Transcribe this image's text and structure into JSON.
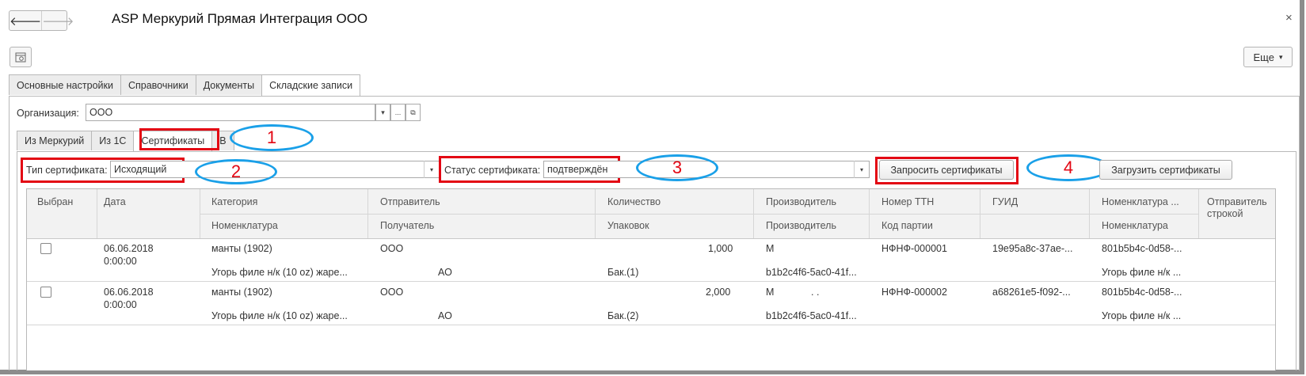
{
  "window": {
    "title": "ASP Меркурий Прямая Интеграция ООО",
    "close_glyph": "×",
    "back_glyph": "🡐",
    "forward_glyph": "🡒"
  },
  "toolbar": {
    "more_label": "Еще",
    "more_arrow": "▾"
  },
  "tabs": [
    {
      "label": "Основные настройки"
    },
    {
      "label": "Справочники"
    },
    {
      "label": "Документы"
    },
    {
      "label": "Складские записи",
      "active": true
    }
  ],
  "organization": {
    "label": "Организация:",
    "value": "ООО",
    "dots": "...",
    "open_glyph": "⧉",
    "arrow": "▾"
  },
  "subtabs": [
    {
      "label": "Из Меркурий"
    },
    {
      "label": "Из 1С"
    },
    {
      "label": "Сертификаты",
      "active": true
    },
    {
      "label": "В"
    }
  ],
  "filters": {
    "type_label": "Тип сертификата:",
    "type_value": "Исходящий",
    "status_label": "Статус сертификата:",
    "status_value": "подтверждён",
    "arrow": "▾",
    "request_button": "Запросить сертификаты",
    "load_button": "Загрузить сертификаты"
  },
  "callouts": [
    "1",
    "2",
    "3",
    "4"
  ],
  "table": {
    "headers_top": [
      "Выбран",
      "Дата",
      "Категория",
      "Отправитель",
      "Количество",
      "Производитель",
      "Номер ТТН",
      "ГУИД",
      "Номенклатура ...",
      "Отправитель строкой"
    ],
    "headers_bottom": [
      "Номенклатура",
      "Получатель",
      "Упаковок",
      "Производитель",
      "Код партии",
      "Номенклатура"
    ],
    "rows": [
      {
        "date": "06.06.2018",
        "time": "0:00:00",
        "category": "манты (1902)",
        "nomenclature": "Угорь филе н/к (10 oz) жаре...",
        "sender": "ООО",
        "receiver": "АО",
        "quantity": "1,000",
        "packages": "Бак.(1)",
        "producer": "М",
        "producer2": "b1b2c4f6-5ac0-41f...",
        "ttn": "НФНФ-000001",
        "guid": "19e95a8c-37ae-...",
        "nom_guid": "801b5b4c-0d58-...",
        "nom2": "Угорь филе н/к ..."
      },
      {
        "date": "06.06.2018",
        "time": "0:00:00",
        "category": "манты (1902)",
        "nomenclature": "Угорь филе н/к (10 oz) жаре...",
        "sender": "ООО",
        "receiver": "АО",
        "quantity": "2,000",
        "packages": "Бак.(2)",
        "producer": "М",
        "producer_dots": ". .",
        "producer2": "b1b2c4f6-5ac0-41f...",
        "ttn": "НФНФ-000002",
        "guid": "a68261e5-f092-...",
        "nom_guid": "801b5b4c-0d58-...",
        "nom2": "Угорь филе н/к ..."
      }
    ]
  },
  "colors": {
    "highlight_red": "#e30613",
    "ellipse_blue": "#1aa0e8"
  }
}
